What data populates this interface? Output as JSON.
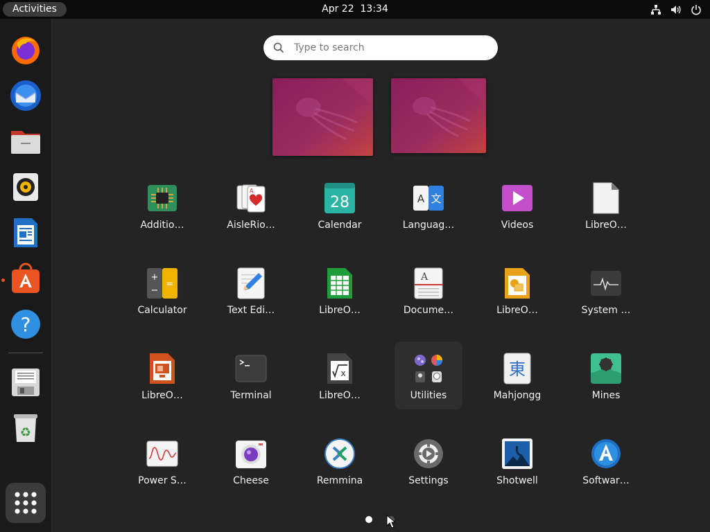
{
  "topbar": {
    "activities_label": "Activities",
    "date": "Apr 22",
    "time": "13:34",
    "tray_icons": [
      "network-icon",
      "volume-icon",
      "power-icon"
    ]
  },
  "dock": {
    "items": [
      {
        "name": "Firefox",
        "icon": "firefox-icon"
      },
      {
        "name": "Thunderbird",
        "icon": "thunderbird-icon"
      },
      {
        "name": "Files",
        "icon": "files-icon"
      },
      {
        "name": "Rhythmbox",
        "icon": "rhythmbox-icon"
      },
      {
        "name": "LibreOffice Writer",
        "icon": "writer-icon"
      },
      {
        "name": "Ubuntu Software",
        "icon": "software-icon",
        "running": true
      },
      {
        "name": "Help",
        "icon": "help-icon"
      },
      {
        "name": "Save",
        "icon": "drive-icon"
      },
      {
        "name": "Trash",
        "icon": "trash-icon"
      },
      {
        "name": "Show Applications",
        "icon": "app-grid-icon"
      }
    ]
  },
  "search": {
    "placeholder": "Type to search",
    "value": ""
  },
  "apps": [
    {
      "label": "Additio…",
      "icon": "chip-icon"
    },
    {
      "label": "AisleRio…",
      "icon": "cards-icon"
    },
    {
      "label": "Calendar",
      "icon": "calendar-icon",
      "day": "28"
    },
    {
      "label": "Languag…",
      "icon": "language-icon",
      "glyphs": [
        "A",
        "文"
      ]
    },
    {
      "label": "Videos",
      "icon": "videos-icon"
    },
    {
      "label": "LibreO…",
      "icon": "libreoffice-icon"
    },
    {
      "label": "Calculator",
      "icon": "calculator-icon"
    },
    {
      "label": "Text Edi…",
      "icon": "text-editor-icon"
    },
    {
      "label": "LibreO…",
      "icon": "calc-icon"
    },
    {
      "label": "Docume…",
      "icon": "document-viewer-icon"
    },
    {
      "label": "LibreO…",
      "icon": "draw-icon"
    },
    {
      "label": "System …",
      "icon": "system-monitor-icon"
    },
    {
      "label": "LibreO…",
      "icon": "impress-icon"
    },
    {
      "label": "Terminal",
      "icon": "terminal-icon"
    },
    {
      "label": "LibreO…",
      "icon": "math-icon"
    },
    {
      "label": "Utilities",
      "icon": "folder-icon",
      "folder": true
    },
    {
      "label": "Mahjongg",
      "icon": "mahjongg-icon",
      "glyph": "東"
    },
    {
      "label": "Mines",
      "icon": "mines-icon"
    },
    {
      "label": "Power S…",
      "icon": "power-statistics-icon"
    },
    {
      "label": "Cheese",
      "icon": "cheese-icon"
    },
    {
      "label": "Remmina",
      "icon": "remmina-icon"
    },
    {
      "label": "Settings",
      "icon": "settings-icon"
    },
    {
      "label": "Shotwell",
      "icon": "shotwell-icon"
    },
    {
      "label": "Softwar…",
      "icon": "software-icon"
    }
  ],
  "pager": {
    "pages": 2,
    "current": 1
  }
}
